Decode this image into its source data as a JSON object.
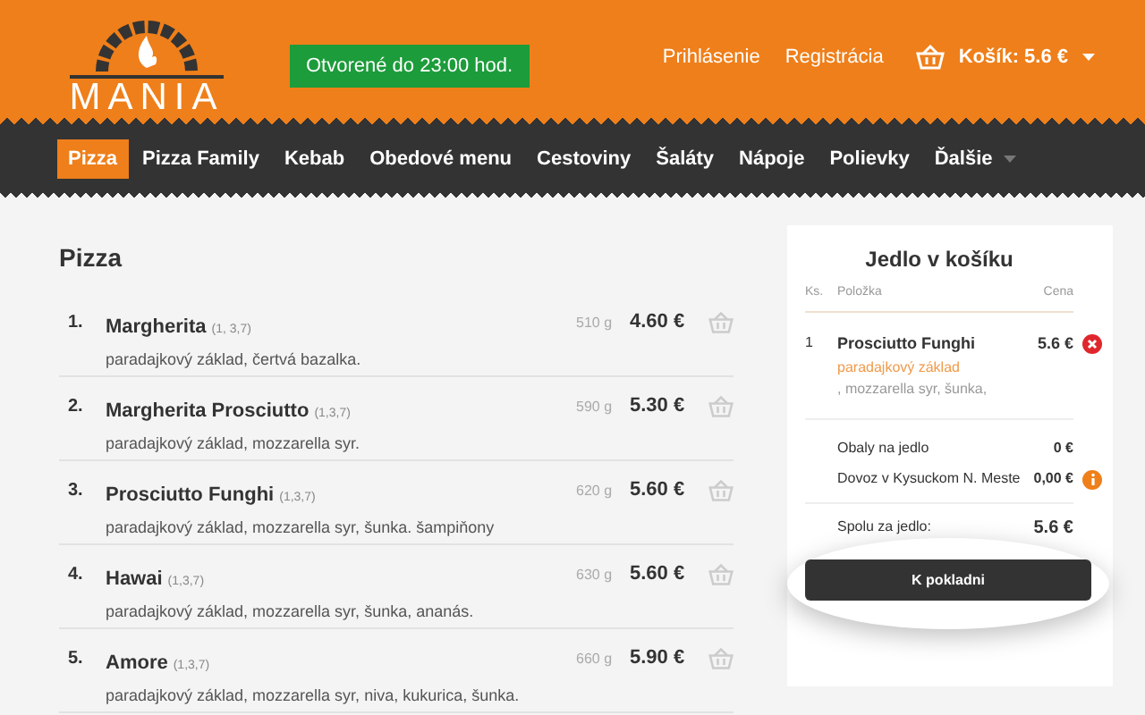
{
  "header": {
    "logo_text": "MANIA",
    "open_badge": "Otvorené do 23:00 hod.",
    "links": [
      "Prihlásenie",
      "Registrácia"
    ],
    "cart_label": "Košík: 5.6 €"
  },
  "nav": [
    {
      "label": "Pizza",
      "selected": true,
      "kind": "plain"
    },
    {
      "label": "Pizza Family",
      "selected": false,
      "kind": "plain"
    },
    {
      "label": "Kebab",
      "selected": false,
      "kind": "plain"
    },
    {
      "label": "Obedové menu",
      "selected": false,
      "kind": "plain"
    },
    {
      "label": "Cestoviny",
      "selected": false,
      "kind": "plain"
    },
    {
      "label": "Šaláty",
      "selected": false,
      "kind": "plain"
    },
    {
      "label": "Nápoje",
      "selected": false,
      "kind": "plain"
    },
    {
      "label": "Polievky",
      "selected": false,
      "kind": "plain"
    },
    {
      "label": "Ďalšie",
      "selected": false,
      "kind": "dropdown"
    }
  ],
  "menu": {
    "title": "Pizza",
    "items": [
      {
        "number": "1.",
        "name": "Margherita",
        "allergens": "(1, 3,7)",
        "description": "paradajkový základ, čertvá bazalka.",
        "weight": "510 g",
        "price": "4.60 €"
      },
      {
        "number": "2.",
        "name": "Margherita Prosciutto",
        "allergens": "(1,3,7)",
        "description": "paradajkový základ, mozzarella syr.",
        "weight": "590 g",
        "price": "5.30 €"
      },
      {
        "number": "3.",
        "name": "Prosciutto Funghi",
        "allergens": "(1,3,7)",
        "description": "paradajkový základ, mozzarella syr, šunka. šampiňony",
        "weight": "620 g",
        "price": "5.60 €"
      },
      {
        "number": "4.",
        "name": "Hawai",
        "allergens": "(1,3,7)",
        "description": "paradajkový základ, mozzarella syr, šunka, ananás.",
        "weight": "630 g",
        "price": "5.60 €"
      },
      {
        "number": "5.",
        "name": "Amore",
        "allergens": "(1,3,7)",
        "description": "paradajkový základ, mozzarella syr, niva, kukurica, šunka.",
        "weight": "660 g",
        "price": "5.90 €"
      }
    ]
  },
  "cart": {
    "title": "Jedlo v košíku",
    "columns": [
      "Ks.",
      "Položka",
      "Cena"
    ],
    "items": [
      {
        "qty": "1",
        "name": "Prosciutto Funghi",
        "price": "5.6 €",
        "ingredients": [
          {
            "text": "paradajkový základ",
            "highlighted": true
          },
          {
            "text": ", mozzarella syr, šunka,",
            "highlighted": false
          }
        ]
      }
    ],
    "fees": [
      {
        "label": "Obaly na jedlo",
        "value": "0 €",
        "kind": "plain"
      },
      {
        "label": "Dovoz v Kysuckom N. Meste",
        "value": "0,00 €",
        "kind": "info"
      }
    ],
    "total_label": "Spolu za jedlo:",
    "total_value": "5.6 €",
    "checkout": "K pokladni"
  }
}
